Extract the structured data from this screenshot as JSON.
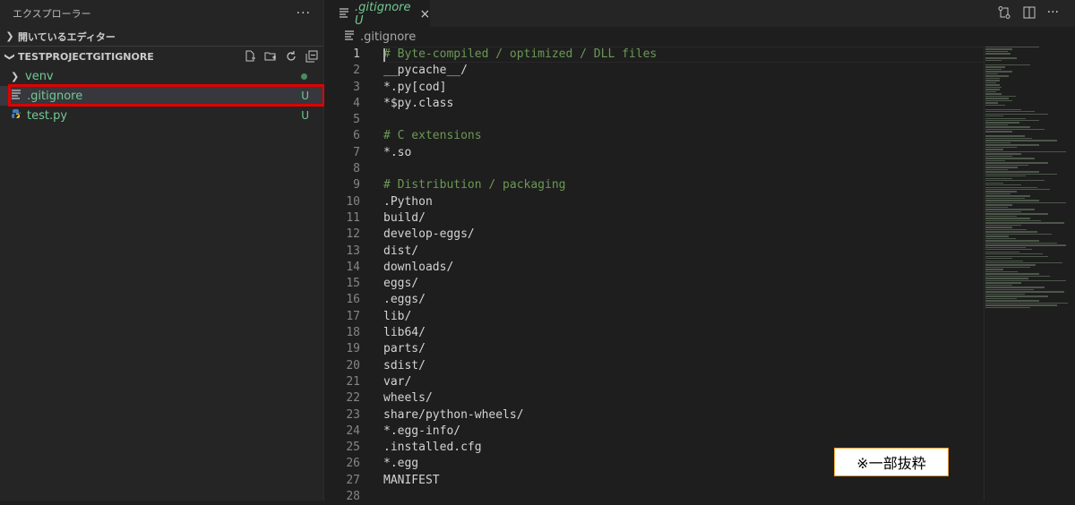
{
  "sidebar": {
    "title": "エクスプローラー",
    "more_icon": "ellipsis-icon",
    "open_editors_label": "開いているエディター",
    "project_label": "TESTPROJECTGITIGNORE",
    "project_actions": [
      "new-file-icon",
      "new-folder-icon",
      "refresh-icon",
      "collapse-all-icon"
    ],
    "items": [
      {
        "name": "venv",
        "kind": "folder",
        "status": "dot"
      },
      {
        "name": ".gitignore",
        "kind": "file",
        "status": "U"
      },
      {
        "name": "test.py",
        "kind": "python",
        "status": "U"
      }
    ]
  },
  "editor": {
    "tab": {
      "title": ".gitignore",
      "status": "U",
      "close": "×"
    },
    "tab_actions": [
      "open-changes-icon",
      "split-editor-icon",
      "ellipsis-icon"
    ],
    "breadcrumb": ".gitignore",
    "active_line": 1,
    "lines": [
      {
        "n": "1",
        "text": "# Byte-compiled / optimized / DLL files",
        "type": "comment"
      },
      {
        "n": "2",
        "text": "__pycache__/",
        "type": "text"
      },
      {
        "n": "3",
        "text": "*.py[cod]",
        "type": "text"
      },
      {
        "n": "4",
        "text": "*$py.class",
        "type": "text"
      },
      {
        "n": "5",
        "text": "",
        "type": "text"
      },
      {
        "n": "6",
        "text": "# C extensions",
        "type": "comment"
      },
      {
        "n": "7",
        "text": "*.so",
        "type": "text"
      },
      {
        "n": "8",
        "text": "",
        "type": "text"
      },
      {
        "n": "9",
        "text": "# Distribution / packaging",
        "type": "comment"
      },
      {
        "n": "10",
        "text": ".Python",
        "type": "text"
      },
      {
        "n": "11",
        "text": "build/",
        "type": "text"
      },
      {
        "n": "12",
        "text": "develop-eggs/",
        "type": "text"
      },
      {
        "n": "13",
        "text": "dist/",
        "type": "text"
      },
      {
        "n": "14",
        "text": "downloads/",
        "type": "text"
      },
      {
        "n": "15",
        "text": "eggs/",
        "type": "text"
      },
      {
        "n": "16",
        "text": ".eggs/",
        "type": "text"
      },
      {
        "n": "17",
        "text": "lib/",
        "type": "text"
      },
      {
        "n": "18",
        "text": "lib64/",
        "type": "text"
      },
      {
        "n": "19",
        "text": "parts/",
        "type": "text"
      },
      {
        "n": "20",
        "text": "sdist/",
        "type": "text"
      },
      {
        "n": "21",
        "text": "var/",
        "type": "text"
      },
      {
        "n": "22",
        "text": "wheels/",
        "type": "text"
      },
      {
        "n": "23",
        "text": "share/python-wheels/",
        "type": "text"
      },
      {
        "n": "24",
        "text": "*.egg-info/",
        "type": "text"
      },
      {
        "n": "25",
        "text": ".installed.cfg",
        "type": "text"
      },
      {
        "n": "26",
        "text": "*.egg",
        "type": "text"
      },
      {
        "n": "27",
        "text": "MANIFEST",
        "type": "text"
      },
      {
        "n": "28",
        "text": "",
        "type": "text"
      }
    ]
  },
  "annotation": {
    "note": "※一部抜粋",
    "highlight_color": "#e00000"
  },
  "colors": {
    "git_untracked": "#73c991",
    "comment": "#6a9955",
    "background": "#1e1e1e",
    "sidebar": "#252526"
  }
}
